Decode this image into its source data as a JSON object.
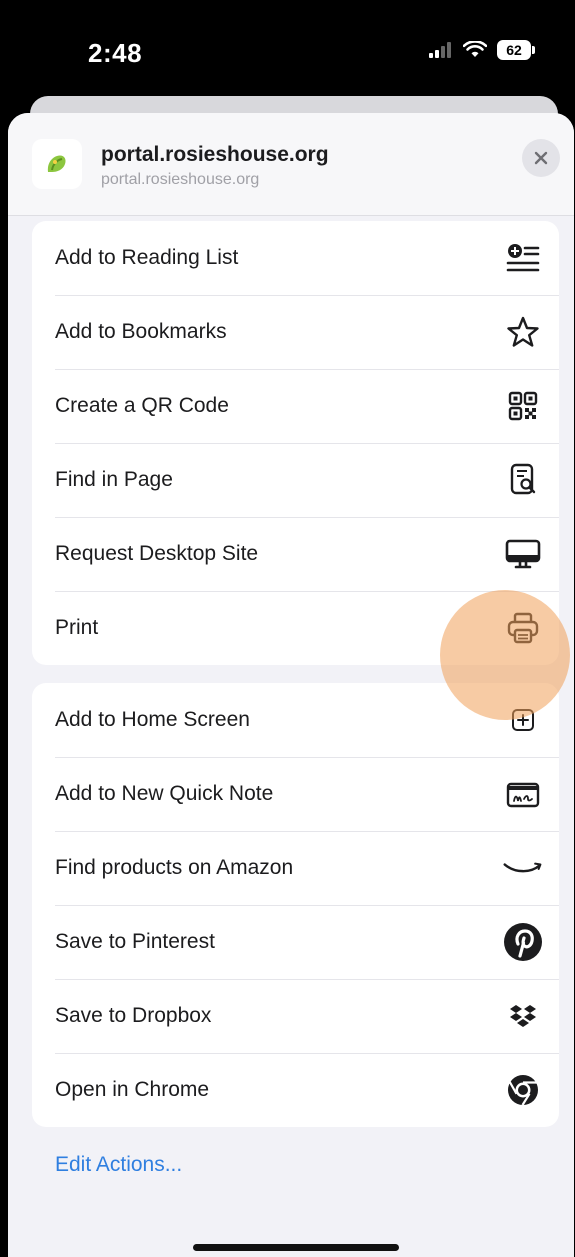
{
  "status": {
    "time": "2:48",
    "battery": "62"
  },
  "site": {
    "title": "portal.rosieshouse.org",
    "subtitle": "portal.rosieshouse.org"
  },
  "group1": [
    {
      "label": "Add to Reading List",
      "icon": "reading-list-icon"
    },
    {
      "label": "Add to Bookmarks",
      "icon": "star-icon"
    },
    {
      "label": "Create a QR Code",
      "icon": "qr-code-icon"
    },
    {
      "label": "Find in Page",
      "icon": "find-in-page-icon"
    },
    {
      "label": "Request Desktop Site",
      "icon": "desktop-icon"
    },
    {
      "label": "Print",
      "icon": "printer-icon"
    }
  ],
  "group2": [
    {
      "label": "Add to Home Screen",
      "icon": "add-square-icon"
    },
    {
      "label": "Add to New Quick Note",
      "icon": "quick-note-icon"
    },
    {
      "label": "Find products on Amazon",
      "icon": "amazon-icon"
    },
    {
      "label": "Save to Pinterest",
      "icon": "pinterest-icon"
    },
    {
      "label": "Save to Dropbox",
      "icon": "dropbox-icon"
    },
    {
      "label": "Open in Chrome",
      "icon": "chrome-icon"
    }
  ],
  "edit_actions": "Edit Actions...",
  "colors": {
    "accent": "#2f7fe0",
    "highlight": "#f0a05a",
    "site_green": "#8cc63f"
  }
}
